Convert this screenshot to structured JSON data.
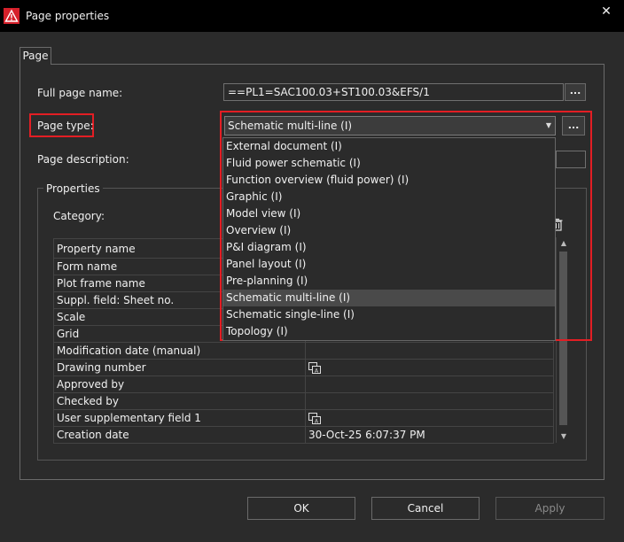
{
  "window": {
    "title": "Page properties",
    "close_glyph": "✕"
  },
  "tab": {
    "label": "Page"
  },
  "full_page_name": {
    "label": "Full page name:",
    "value": "==PL1=SAC100.03+ST100.03&EFS/1",
    "button": "..."
  },
  "page_type": {
    "label": "Page type:",
    "selected": "Schematic multi-line (I)",
    "button": "...",
    "options": [
      "External document (I)",
      "Fluid power schematic (I)",
      "Function overview (fluid power) (I)",
      "Graphic (I)",
      "Model view (I)",
      "Overview (I)",
      "P&I diagram (I)",
      "Panel layout (I)",
      "Pre-planning  (I)",
      "Schematic multi-line (I)",
      "Schematic single-line (I)",
      "Topology (I)"
    ],
    "selected_index": 9
  },
  "page_description": {
    "label": "Page description:"
  },
  "properties": {
    "group_label": "Properties",
    "category_label": "Category:",
    "table": {
      "header": [
        "Property name",
        ""
      ],
      "rows": [
        {
          "name": "Form name",
          "value": "",
          "icon": false
        },
        {
          "name": "Plot frame name",
          "value": "",
          "icon": false
        },
        {
          "name": "Suppl. field: Sheet no.",
          "value": "",
          "icon": false
        },
        {
          "name": "Scale",
          "value": "",
          "icon": false
        },
        {
          "name": "Grid",
          "value": "",
          "icon": false
        },
        {
          "name": "Modification date (manual)",
          "value": "",
          "icon": false
        },
        {
          "name": "Drawing number",
          "value": "",
          "icon": true
        },
        {
          "name": "Approved by",
          "value": "",
          "icon": false
        },
        {
          "name": "Checked by",
          "value": "",
          "icon": false
        },
        {
          "name": "User supplementary field 1",
          "value": "",
          "icon": true
        },
        {
          "name": "Creation date",
          "value": "30-Oct-25 6:07:37 PM",
          "icon": false
        }
      ]
    }
  },
  "buttons": {
    "ok": "OK",
    "cancel": "Cancel",
    "apply": "Apply"
  },
  "colors": {
    "highlight_box": "#e31e24",
    "background": "#2b2b2b",
    "titlebar": "#000000"
  },
  "icons": {
    "app": "warning-triangle-icon",
    "edit": "multilingual-edit-icon",
    "delete": "trash-icon"
  }
}
